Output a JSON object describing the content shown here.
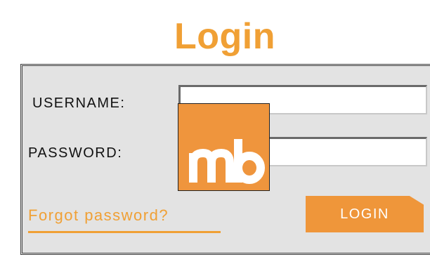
{
  "title": "Login",
  "form": {
    "username_label": "USERNAME:",
    "username_value": "",
    "password_label": "PASSWORD:",
    "password_value": "",
    "forgot_link": "Forgot password?",
    "login_button": "LOGIN"
  },
  "logo": {
    "text": "mb",
    "background": "#ef953d"
  },
  "colors": {
    "accent": "#f0a035",
    "panel_bg": "#e3e3e3",
    "button_bg": "#ef963a"
  }
}
